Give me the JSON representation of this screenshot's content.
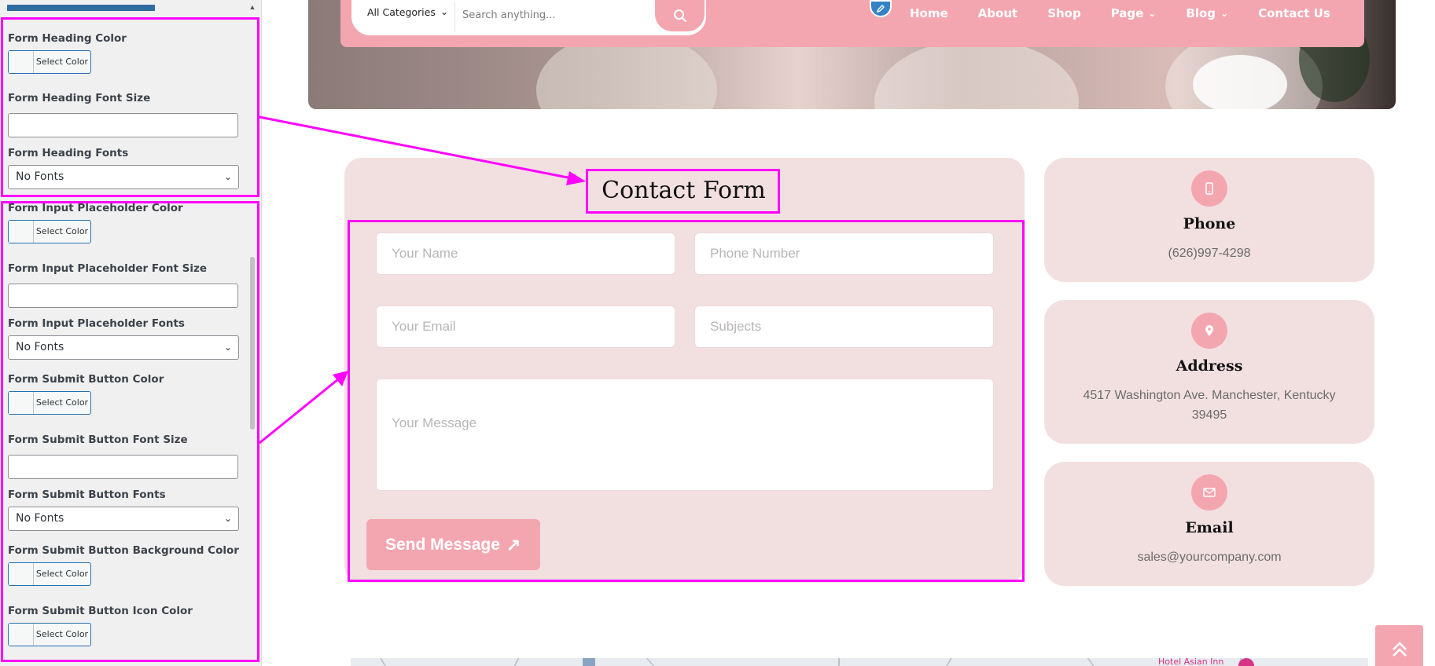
{
  "sidebar": {
    "controls": [
      {
        "label": "Form Heading Color",
        "type": "color",
        "button_text": "Select Color"
      },
      {
        "label": "Form Heading Font Size",
        "type": "text",
        "value": ""
      },
      {
        "label": "Form Heading Fonts",
        "type": "select",
        "value": "No Fonts"
      },
      {
        "label": "Form Input Placeholder Color",
        "type": "color",
        "button_text": "Select Color"
      },
      {
        "label": "Form Input Placeholder Font Size",
        "type": "text",
        "value": ""
      },
      {
        "label": "Form Input Placeholder Fonts",
        "type": "select",
        "value": "No Fonts"
      },
      {
        "label": "Form Submit Button Color",
        "type": "color",
        "button_text": "Select Color"
      },
      {
        "label": "Form Submit Button Font Size",
        "type": "text",
        "value": ""
      },
      {
        "label": "Form Submit Button Fonts",
        "type": "select",
        "value": "No Fonts"
      },
      {
        "label": "Form Submit Button Background Color",
        "type": "color",
        "button_text": "Select Color"
      },
      {
        "label": "Form Submit Button Icon Color",
        "type": "color",
        "button_text": "Select Color"
      }
    ]
  },
  "header": {
    "category_select": "All Categories",
    "search_placeholder": "Search anything...",
    "nav": [
      {
        "label": "Home",
        "dropdown": false
      },
      {
        "label": "About",
        "dropdown": false
      },
      {
        "label": "Shop",
        "dropdown": false
      },
      {
        "label": "Page",
        "dropdown": true
      },
      {
        "label": "Blog",
        "dropdown": true
      },
      {
        "label": "Contact Us",
        "dropdown": false
      }
    ]
  },
  "contact_form": {
    "title": "Contact Form",
    "name_placeholder": "Your Name",
    "phone_placeholder": "Phone Number",
    "email_placeholder": "Your Email",
    "subject_placeholder": "Subjects",
    "message_placeholder": "Your Message",
    "submit_label": "Send Message"
  },
  "info_cards": [
    {
      "icon": "mobile-phone-icon",
      "title": "Phone",
      "text": "(626)997-4298"
    },
    {
      "icon": "map-pin-icon",
      "title": "Address",
      "text": "4517 Washington Ave. Manchester, Kentucky 39495"
    },
    {
      "icon": "envelope-icon",
      "title": "Email",
      "text": "sales@yourcompany.com"
    }
  ],
  "map": {
    "place_label": "Hotel Asian Inn"
  },
  "colors": {
    "accent_pink": "#f4a6b0",
    "card_bg": "#f2e0e1",
    "annotation": "#ff00ff",
    "wp_blue": "#2271b1"
  }
}
